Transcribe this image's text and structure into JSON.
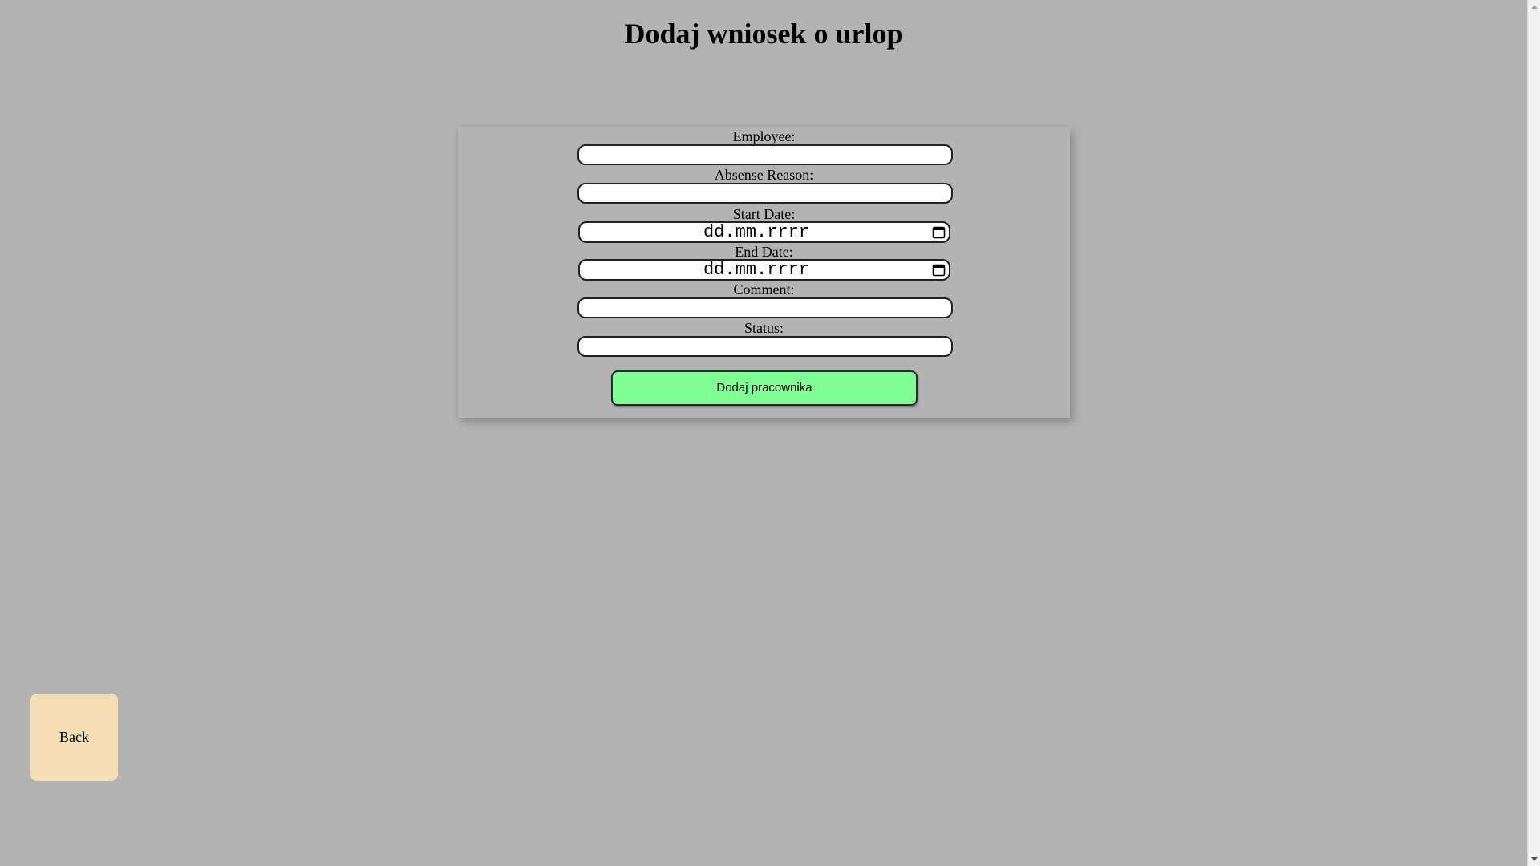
{
  "page": {
    "title": "Dodaj wniosek o urlop"
  },
  "form": {
    "fields": [
      {
        "label": "Employee:",
        "value": ""
      },
      {
        "label": "Absense Reason:",
        "value": ""
      },
      {
        "label": "Start Date:",
        "placeholder": "dd.mm.rrrr"
      },
      {
        "label": "End Date:",
        "placeholder": "dd.mm.rrrr"
      },
      {
        "label": "Comment:",
        "value": ""
      },
      {
        "label": "Status:",
        "value": ""
      }
    ],
    "submit_label": "Dodaj pracownika"
  },
  "nav": {
    "back_label": "Back"
  },
  "colors": {
    "background": "#b3b3b3",
    "submit_button": "#80ff95",
    "back_button": "#f5deb3"
  },
  "icons": {
    "date_picker": "calendar-icon",
    "scroll_up": "scroll-up-arrow-icon",
    "scroll_down": "scroll-down-arrow-icon"
  }
}
